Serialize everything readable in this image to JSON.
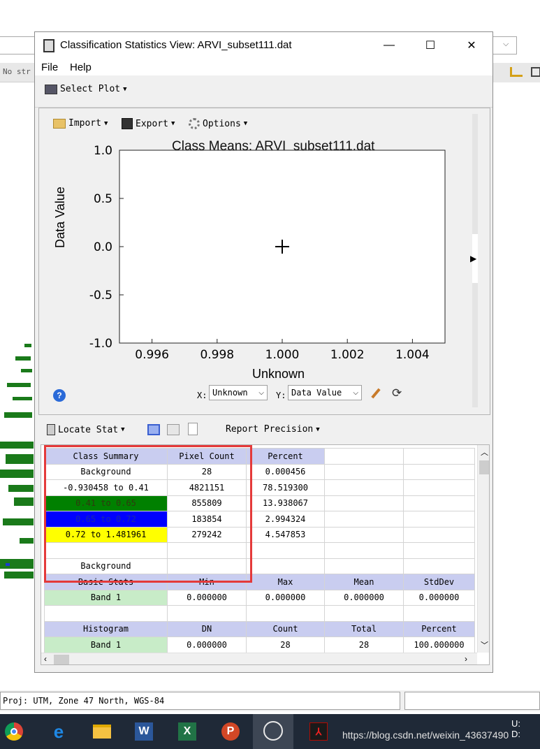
{
  "background_app": {
    "toolbar_text": "No str"
  },
  "window": {
    "title": "Classification Statistics View: ARVI_subset111.dat",
    "controls": {
      "minimize": "—",
      "maximize": "☐",
      "close": "✕"
    },
    "menu": [
      "File",
      "Help"
    ],
    "select_plot_label": "Select Plot"
  },
  "plot": {
    "toolbar": {
      "import": "Import",
      "export": "Export",
      "options": "Options"
    },
    "x_selector_label": "X:",
    "x_selector_value": "Unknown",
    "y_selector_label": "Y:",
    "y_selector_value": "Data Value"
  },
  "chart_data": {
    "type": "scatter",
    "title": "Class Means: ARVI_subset111.dat",
    "xlabel": "Unknown",
    "ylabel": "Data Value",
    "xlim": [
      0.995,
      1.005
    ],
    "ylim": [
      -1.0,
      1.0
    ],
    "x_ticks": [
      "0.996",
      "0.998",
      "1.000",
      "1.002",
      "1.004"
    ],
    "x_tick_values": [
      0.996,
      0.998,
      1.0,
      1.002,
      1.004
    ],
    "y_ticks": [
      "1.0",
      "0.5",
      "0.0",
      "-0.5",
      "-1.0"
    ],
    "y_tick_values": [
      1.0,
      0.5,
      0.0,
      -0.5,
      -1.0
    ],
    "points": [
      {
        "x": 1.0,
        "y": 0.0,
        "marker": "+"
      }
    ],
    "grid": false
  },
  "stats": {
    "locate_stat_label": "Locate Stat",
    "report_precision_label": "Report Precision",
    "class_summary": {
      "headers": [
        "Class Summary",
        "Pixel Count",
        "Percent"
      ],
      "rows": [
        {
          "label": "Background",
          "count": "28",
          "percent": "0.000456",
          "color": "#ffffff"
        },
        {
          "label": "-0.930458 to 0.41",
          "count": "4821151",
          "percent": "78.519300",
          "color": "#ffffff"
        },
        {
          "label": "0.41 to 0.65",
          "count": "855809",
          "percent": "13.938067",
          "color": "#008000"
        },
        {
          "label": "0.65 to 0.72",
          "count": "183854",
          "percent": "2.994324",
          "color": "#0000ff"
        },
        {
          "label": "0.72 to 1.481961",
          "count": "279242",
          "percent": "4.547853",
          "color": "#ffff00"
        }
      ]
    },
    "section_label": "Background",
    "basic_stats": {
      "headers": [
        "Basic Stats",
        "Min",
        "Max",
        "Mean",
        "StdDev"
      ],
      "row": [
        "Band 1",
        "0.000000",
        "0.000000",
        "0.000000",
        "0.000000"
      ]
    },
    "histogram": {
      "headers": [
        "Histogram",
        "DN",
        "Count",
        "Total",
        "Percent"
      ],
      "row": [
        "Band 1",
        "0.000000",
        "28",
        "28",
        "100.000000"
      ]
    }
  },
  "status_bar": {
    "projection": "Proj: UTM, Zone 47 North, WGS-84"
  },
  "taskbar": {
    "watermark": "https://blog.csdn.net/weixin_43637490",
    "tray_text": "U:",
    "tray_text2": "D:"
  },
  "colors": {
    "header_bg": "#c9cdf0",
    "band_bg": "#c8ecc8",
    "highlight_box": "#e43a3a"
  }
}
